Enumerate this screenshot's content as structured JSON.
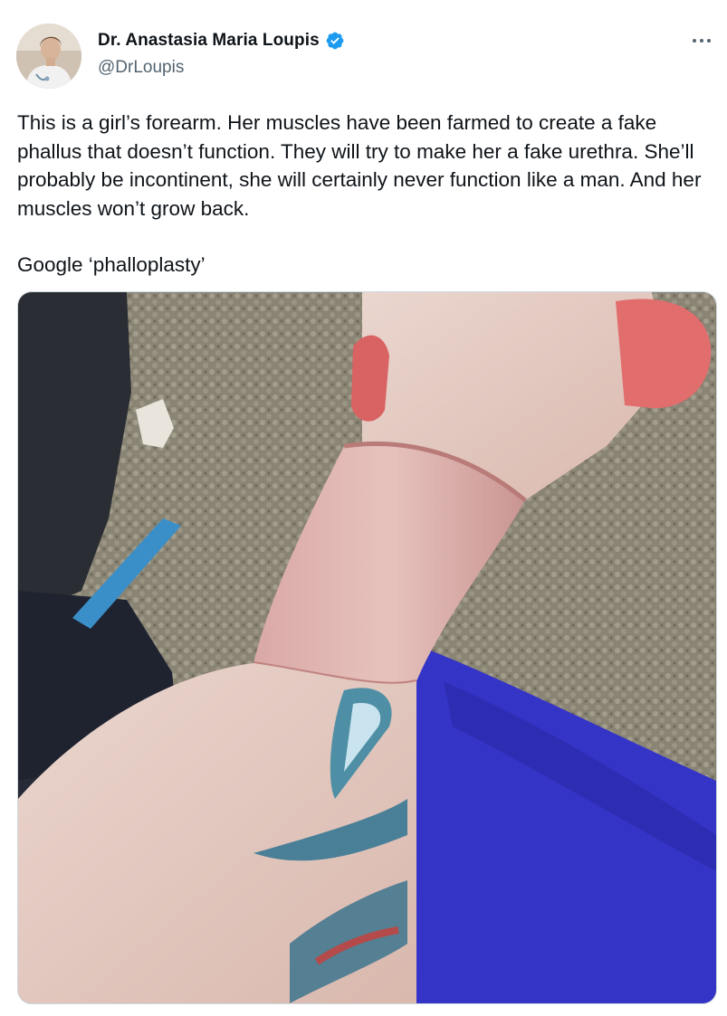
{
  "author": {
    "display_name": "Dr. Anastasia Maria Loupis",
    "handle": "@DrLoupis",
    "verified": true,
    "verified_color": "#1d9bf0",
    "avatar_icon": "avatar-photo"
  },
  "menu": {
    "icon": "more-horizontal-icon"
  },
  "tweet": {
    "paragraphs": [
      "This is a girl’s forearm. Her muscles have been farmed to create a fake phallus that doesn’t function. They will try to make her a fake urethra. She’ll probably be incontinent, she will certainly never function like a man. And her muscles won’t grow back.",
      "Google ‘phalloplasty’"
    ]
  },
  "colors": {
    "text": "#0f1419",
    "secondary": "#536471",
    "border": "#cfd9de"
  }
}
